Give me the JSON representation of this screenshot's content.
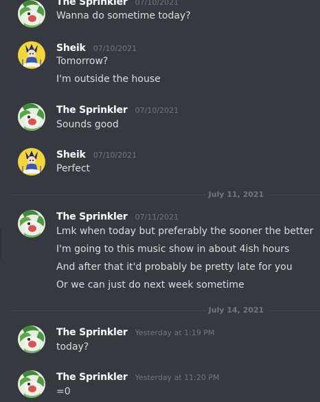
{
  "messages": [
    {
      "author": "The Sprinkler",
      "timestamp": "07/10/2021",
      "avatar_icon": "sprinkler-avatar-icon",
      "lines": [
        "Wanna do sometime today?"
      ]
    },
    {
      "author": "Sheik",
      "timestamp": "07/10/2021",
      "avatar_icon": "sheik-avatar-icon",
      "lines": [
        "Tomorrow?",
        "I'm outside the house"
      ]
    },
    {
      "author": "The Sprinkler",
      "timestamp": "07/10/2021",
      "avatar_icon": "sprinkler-avatar-icon",
      "lines": [
        "Sounds good"
      ]
    },
    {
      "author": "Sheik",
      "timestamp": "07/10/2021",
      "avatar_icon": "sheik-avatar-icon",
      "lines": [
        "Perfect"
      ]
    },
    {
      "author": "The Sprinkler",
      "timestamp": "07/11/2021",
      "avatar_icon": "sprinkler-avatar-icon",
      "lines": [
        "Lmk when today but preferably the sooner the better",
        "I'm going to this music show in about 4ish hours",
        "And after that it'd probably be pretty late for you",
        "Or we can just do next week sometime"
      ]
    },
    {
      "author": "The Sprinkler",
      "timestamp": "Yesterday at 1:19 PM",
      "avatar_icon": "sprinkler-avatar-icon",
      "lines": [
        "today?"
      ]
    },
    {
      "author": "The Sprinkler",
      "timestamp": "Yesterday at 11:20 PM",
      "avatar_icon": "sprinkler-avatar-icon",
      "lines": [
        "=0"
      ]
    }
  ],
  "dividers": [
    {
      "label": "July 11, 2021"
    },
    {
      "label": "July 14, 2021"
    }
  ],
  "colors": {
    "background": "#36393f",
    "author": "#ffffff",
    "timestamp": "#72767d",
    "message_text": "#dcddde",
    "divider_line": "#42454a"
  }
}
